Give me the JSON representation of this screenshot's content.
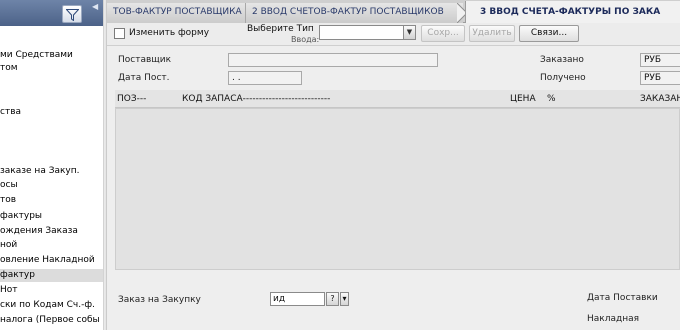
{
  "sidebar": {
    "items": [
      "ми Средствами",
      "том",
      "ства",
      "заказе на Закуп.",
      "осы",
      "тов",
      "фактуры",
      "ождения Заказа",
      "ной",
      "овление Накладной",
      "фактур",
      "Нот",
      "ски по Кодам Сч.-ф.",
      "налога (Первое собы"
    ],
    "selected_index": 10
  },
  "tabs": [
    "ТОВ-ФАКТУР ПОСТАВЩИКА",
    "2 ВВОД СЧЕТОВ-ФАКТУР ПОСТАВЩИКОВ",
    "3 ВВОД СЧЕТА-ФАКТУРЫ ПО ЗАКА"
  ],
  "toolbar": {
    "change_form_label": "Изменить форму",
    "select_type_label_line1": "Выберите Тип",
    "select_type_label_line2": "Ввода:",
    "type_value": "",
    "save_label": "Сохр...",
    "delete_label": "Удалить",
    "links_label": "Связи..."
  },
  "form": {
    "supplier_label": "Поставщик",
    "supplier_value": "",
    "post_date_label": "Дата Пост.",
    "post_date_value": ". .",
    "ordered_label": "Заказано",
    "ordered_currency": "РУБ",
    "received_label": "Получено",
    "received_currency": "РУБ"
  },
  "grid": {
    "columns": {
      "pos": "ПОЗ---",
      "stock_code": "КОД ЗАПАСА---------------------------",
      "price": "ЦЕНА",
      "percent": "%",
      "ordered": "ЗАКАЗАН"
    }
  },
  "footer": {
    "purchase_order_label": "Заказ на Закупку",
    "purchase_order_value": "ид",
    "help_label": "?",
    "dropdown_label": "▾",
    "delivery_date_label": "Дата Поставки",
    "waybill_label": "Накладная"
  },
  "colors": {
    "header_blue": "#5a7098",
    "active_tab_text": "#1c2a5a",
    "tab_text": "#2a3a6a"
  }
}
